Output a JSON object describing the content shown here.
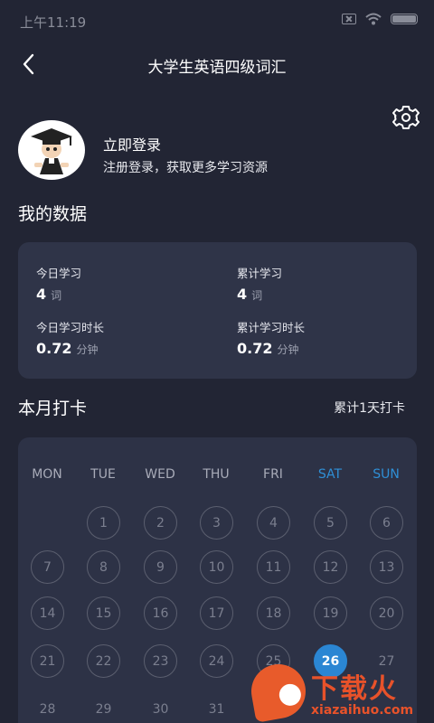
{
  "status_bar": {
    "time": "上午11:19"
  },
  "header": {
    "title": "大学生英语四级词汇"
  },
  "profile": {
    "login_title": "立即登录",
    "login_subtitle": "注册登录，获取更多学习资源"
  },
  "my_data": {
    "title": "我的数据",
    "today_words_label": "今日学习",
    "today_words_value": "4",
    "today_words_unit": "词",
    "total_words_label": "累计学习",
    "total_words_value": "4",
    "total_words_unit": "词",
    "today_time_label": "今日学习时长",
    "today_time_value": "0.72",
    "today_time_unit": "分钟",
    "total_time_label": "累计学习时长",
    "total_time_value": "0.72",
    "total_time_unit": "分钟"
  },
  "checkin": {
    "title": "本月打卡",
    "total": "累计1天打卡",
    "weekdays": [
      "MON",
      "TUE",
      "WED",
      "THU",
      "FRI",
      "SAT",
      "SUN"
    ],
    "days": [
      "1",
      "2",
      "3",
      "4",
      "5",
      "6",
      "7",
      "8",
      "9",
      "10",
      "11",
      "12",
      "13",
      "14",
      "15",
      "16",
      "17",
      "18",
      "19",
      "20",
      "21",
      "22",
      "23",
      "24",
      "25",
      "26",
      "27",
      "28",
      "29",
      "30",
      "31"
    ],
    "today": "26"
  },
  "watermark": {
    "brand": "下载火",
    "url": "xiazaihuo.com"
  },
  "colors": {
    "accent": "#2b86d3",
    "background": "#222534",
    "card": "#2f3448",
    "brand_orange": "#e8522a"
  },
  "icons": {
    "back": "chevron-left-icon",
    "settings": "gear-icon"
  }
}
